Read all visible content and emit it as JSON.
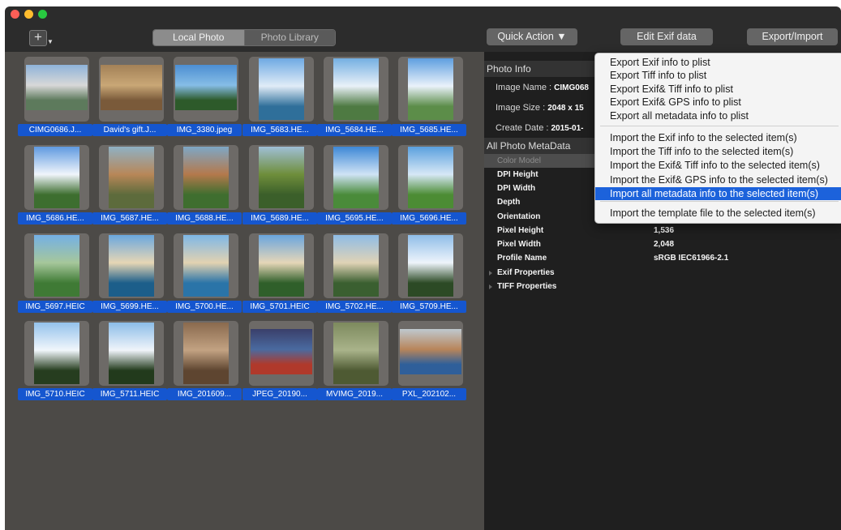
{
  "toolbar": {
    "add_label": "+",
    "tabs": [
      "Local Photo",
      "Photo Library"
    ],
    "quick_action": "Quick Action ▼",
    "edit_exif": "Edit Exif data",
    "export_import": "Export/Import"
  },
  "photos": [
    "CIMG0686.J...",
    "David's gift.J...",
    "IMG_3380.jpeg",
    "IMG_5683.HE...",
    "IMG_5684.HE...",
    "IMG_5685.HE...",
    "IMG_5686.HE...",
    "IMG_5687.HE...",
    "IMG_5688.HE...",
    "IMG_5689.HE...",
    "IMG_5695.HE...",
    "IMG_5696.HE...",
    "IMG_5697.HEIC",
    "IMG_5699.HE...",
    "IMG_5700.HE...",
    "IMG_5701.HEIC",
    "IMG_5702.HE...",
    "IMG_5709.HE...",
    "IMG_5710.HEIC",
    "IMG_5711.HEIC",
    "IMG_201609...",
    "JPEG_20190...",
    "MVIMG_2019...",
    "PXL_202102..."
  ],
  "photo_info": {
    "header": "Photo Info",
    "image_name_label": "Image Name :",
    "image_name_value": "CIMG068",
    "image_size_label": "Image Size :",
    "image_size_value": "2048 x 15",
    "create_date_label": "Create Date :",
    "create_date_value": "2015-01-"
  },
  "metadata": {
    "header": "All Photo MetaData",
    "rows": [
      {
        "key": "Color Model",
        "value": ""
      },
      {
        "key": "DPI Height",
        "value": ""
      },
      {
        "key": "DPI Width",
        "value": ""
      },
      {
        "key": "Depth",
        "value": ""
      },
      {
        "key": "Orientation",
        "value": ""
      },
      {
        "key": "Pixel Height",
        "value": "1,536"
      },
      {
        "key": "Pixel Width",
        "value": "2,048"
      },
      {
        "key": "Profile Name",
        "value": "sRGB IEC61966-2.1"
      },
      {
        "key": "Exif Properties",
        "value": ""
      },
      {
        "key": "TIFF Properties",
        "value": ""
      }
    ]
  },
  "menu": {
    "export_items": [
      "Export Exif info to plist",
      "Export Tiff info to plist",
      "Export Exif& Tiff info to plist",
      "Export Exif& GPS info to plist",
      "Export all metadata info to plist"
    ],
    "import_items": [
      "Import the Exif info to the selected item(s)",
      "Import the Tiff info to the selected item(s)",
      "Import the Exif& Tiff info to the selected item(s)",
      "Import the Exif& GPS info to the selected item(s)",
      "Import all metadata info to the selected item(s)"
    ],
    "template_item": "Import the template file to the selected item(s)",
    "highlighted": "Import all metadata info to the selected item(s)"
  },
  "colors": {
    "selection": "#1556cf",
    "menu_highlight": "#1c62db",
    "grid_bg": "#4c4a47",
    "right_bg": "#1f1f1f"
  }
}
